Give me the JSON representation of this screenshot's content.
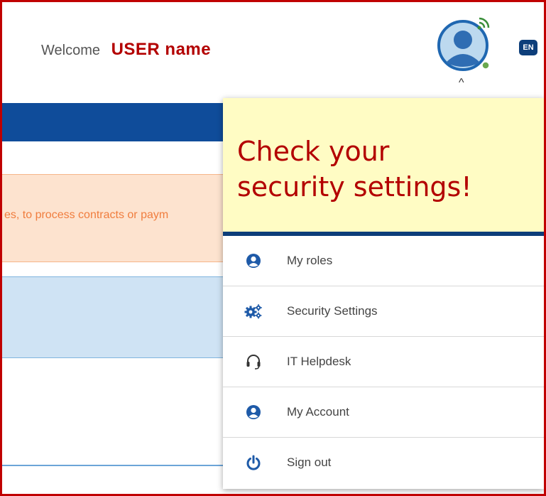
{
  "header": {
    "welcome_text": "Welcome",
    "user_name": "USER name",
    "language_label": "EN"
  },
  "banner": {
    "text": "es, to process contracts or paym"
  },
  "callout": {
    "text": "Check your security settings!"
  },
  "menu": {
    "items": [
      {
        "label": "My roles",
        "icon": "user-circle-icon"
      },
      {
        "label": "Security Settings",
        "icon": "gears-icon"
      },
      {
        "label": "IT Helpdesk",
        "icon": "headset-icon"
      },
      {
        "label": "My Account",
        "icon": "user-circle-icon"
      },
      {
        "label": "Sign out",
        "icon": "power-icon"
      }
    ]
  },
  "colors": {
    "brand_blue": "#0f4c9a",
    "highlight_red": "#b30000",
    "callout_bg": "#fffcc4",
    "warning_orange": "#f07d3e"
  }
}
